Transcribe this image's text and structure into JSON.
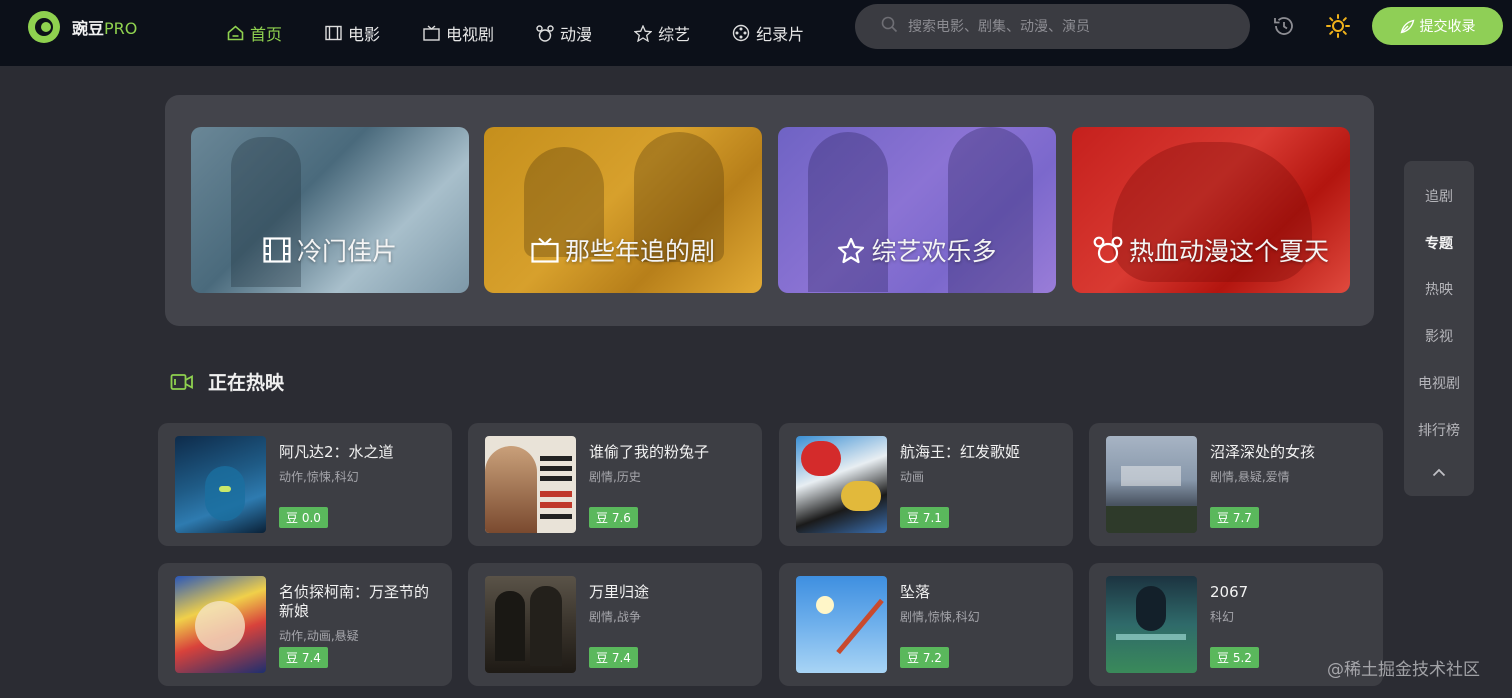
{
  "header": {
    "logo_text": "豌豆",
    "logo_suffix": "PRO",
    "nav": [
      {
        "label": "首页",
        "icon": "home-icon"
      },
      {
        "label": "电影",
        "icon": "film-icon"
      },
      {
        "label": "电视剧",
        "icon": "tv-icon"
      },
      {
        "label": "动漫",
        "icon": "mickey-icon"
      },
      {
        "label": "综艺",
        "icon": "star-icon"
      },
      {
        "label": "纪录片",
        "icon": "reel-icon"
      }
    ],
    "active_nav": "首页",
    "search_placeholder": "搜索电影、剧集、动漫、演员",
    "submit_label": "提交收录"
  },
  "banner": [
    {
      "label": "冷门佳片",
      "icon": "film-icon"
    },
    {
      "label": "那些年追的剧",
      "icon": "tv-icon"
    },
    {
      "label": "综艺欢乐多",
      "icon": "star-icon"
    },
    {
      "label": "热血动漫这个夏天",
      "icon": "mickey-icon"
    }
  ],
  "section": {
    "title": "正在热映"
  },
  "movies": [
    {
      "title": "阿凡达2：水之道",
      "genre": "动作,惊悚,科幻",
      "rating": "豆 0.0"
    },
    {
      "title": "谁偷了我的粉兔子",
      "genre": "剧情,历史",
      "rating": "豆 7.6"
    },
    {
      "title": "航海王：红发歌姬",
      "genre": "动画",
      "rating": "豆 7.1"
    },
    {
      "title": "沼泽深处的女孩",
      "genre": "剧情,悬疑,爱情",
      "rating": "豆 7.7"
    },
    {
      "title": "名侦探柯南：万圣节的新娘",
      "genre": "动作,动画,悬疑",
      "rating": "豆 7.4"
    },
    {
      "title": "万里归途",
      "genre": "剧情,战争",
      "rating": "豆 7.4"
    },
    {
      "title": "坠落",
      "genre": "剧情,惊悚,科幻",
      "rating": "豆 7.2"
    },
    {
      "title": "2067",
      "genre": "科幻",
      "rating": "豆 5.2"
    }
  ],
  "sidenav": [
    {
      "label": "追剧"
    },
    {
      "label": "专题"
    },
    {
      "label": "热映"
    },
    {
      "label": "影视"
    },
    {
      "label": "电视剧"
    },
    {
      "label": "排行榜"
    }
  ],
  "sidenav_active": "专题",
  "watermark": "@稀土掘金技术社区",
  "colors": {
    "accent": "#8fd14f",
    "rating": "#5ab85c",
    "header_bg": "#0c1019",
    "page_bg": "#2b2c33"
  }
}
